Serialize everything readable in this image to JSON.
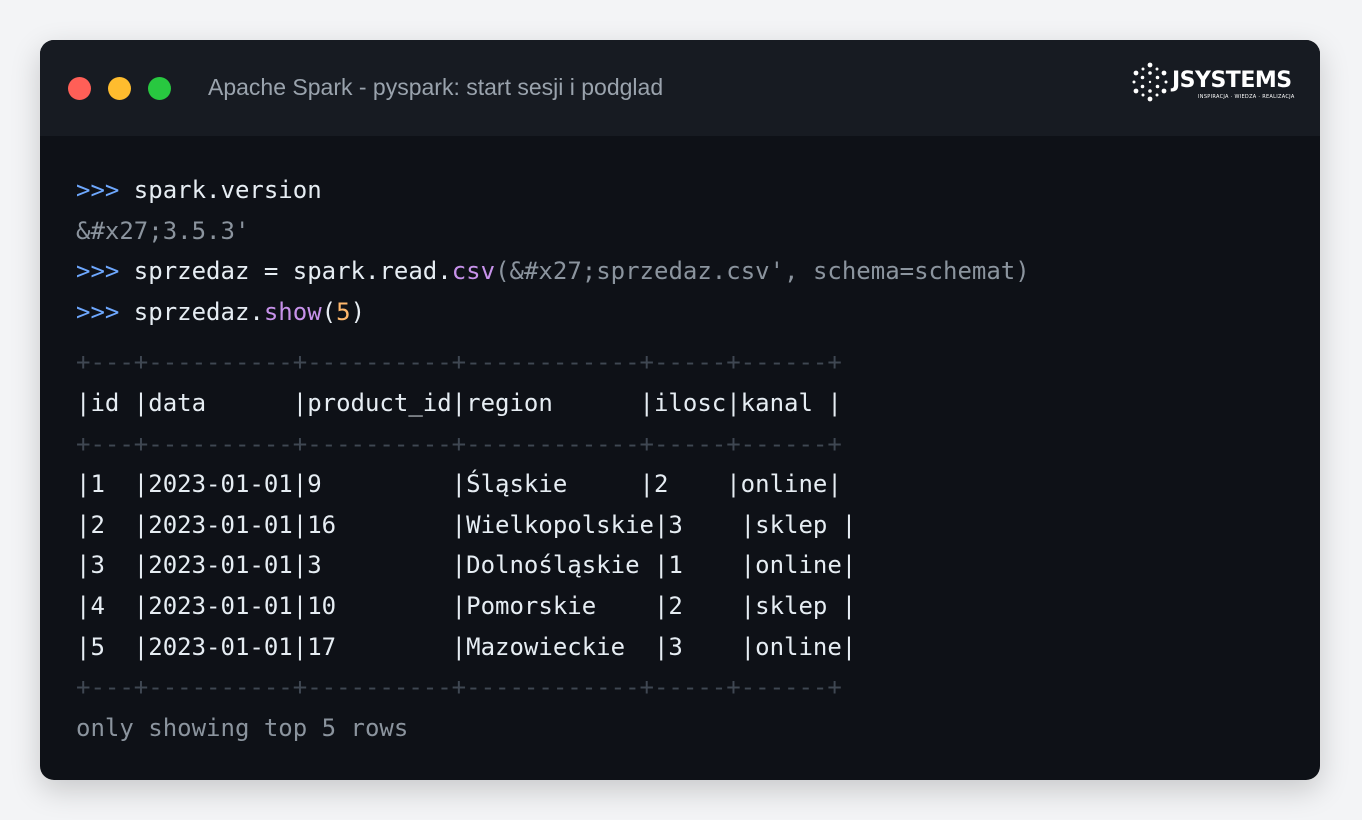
{
  "window": {
    "title": "Apache Spark - pyspark: start sesji i podglad",
    "traffic_lights": {
      "close_color": "#ff5f57",
      "minimize_color": "#febc2e",
      "zoom_color": "#28c840"
    }
  },
  "logo": {
    "icon": "jsystems-dots-logo-icon",
    "wordmark": "JSYSTEMS",
    "tagline": "INSPIRACJA · WIEDZA · REALIZACJA"
  },
  "terminal": {
    "prompt": ">>>",
    "cmd1": {
      "text": " spark.version"
    },
    "out1": "&#x27;3.5.3'",
    "cmd2": {
      "pre": " sprzedaz = spark.read.",
      "func": "csv",
      "open": "(",
      "arg": "&#x27;sprzedaz.csv', schema=schemat",
      "close": ")"
    },
    "cmd3": {
      "pre": " sprzedaz.",
      "func": "show",
      "open": "(",
      "num": "5",
      "close": ")"
    },
    "table": {
      "separator": "+---+----------+----------+------------+-----+------+",
      "header": "|id |data      |product_id|region      |ilosc|kanal |",
      "rows": [
        "|1  |2023-01-01|9         |Śląskie     |2    |online|",
        "|2  |2023-01-01|16        |Wielkopolskie|3    |sklep |",
        "|3  |2023-01-01|3         |Dolnośląskie |1    |online|",
        "|4  |2023-01-01|10        |Pomorskie    |2    |sklep |",
        "|5  |2023-01-01|17        |Mazowieckie  |3    |online|"
      ]
    },
    "footer": "only showing top 5 rows"
  }
}
